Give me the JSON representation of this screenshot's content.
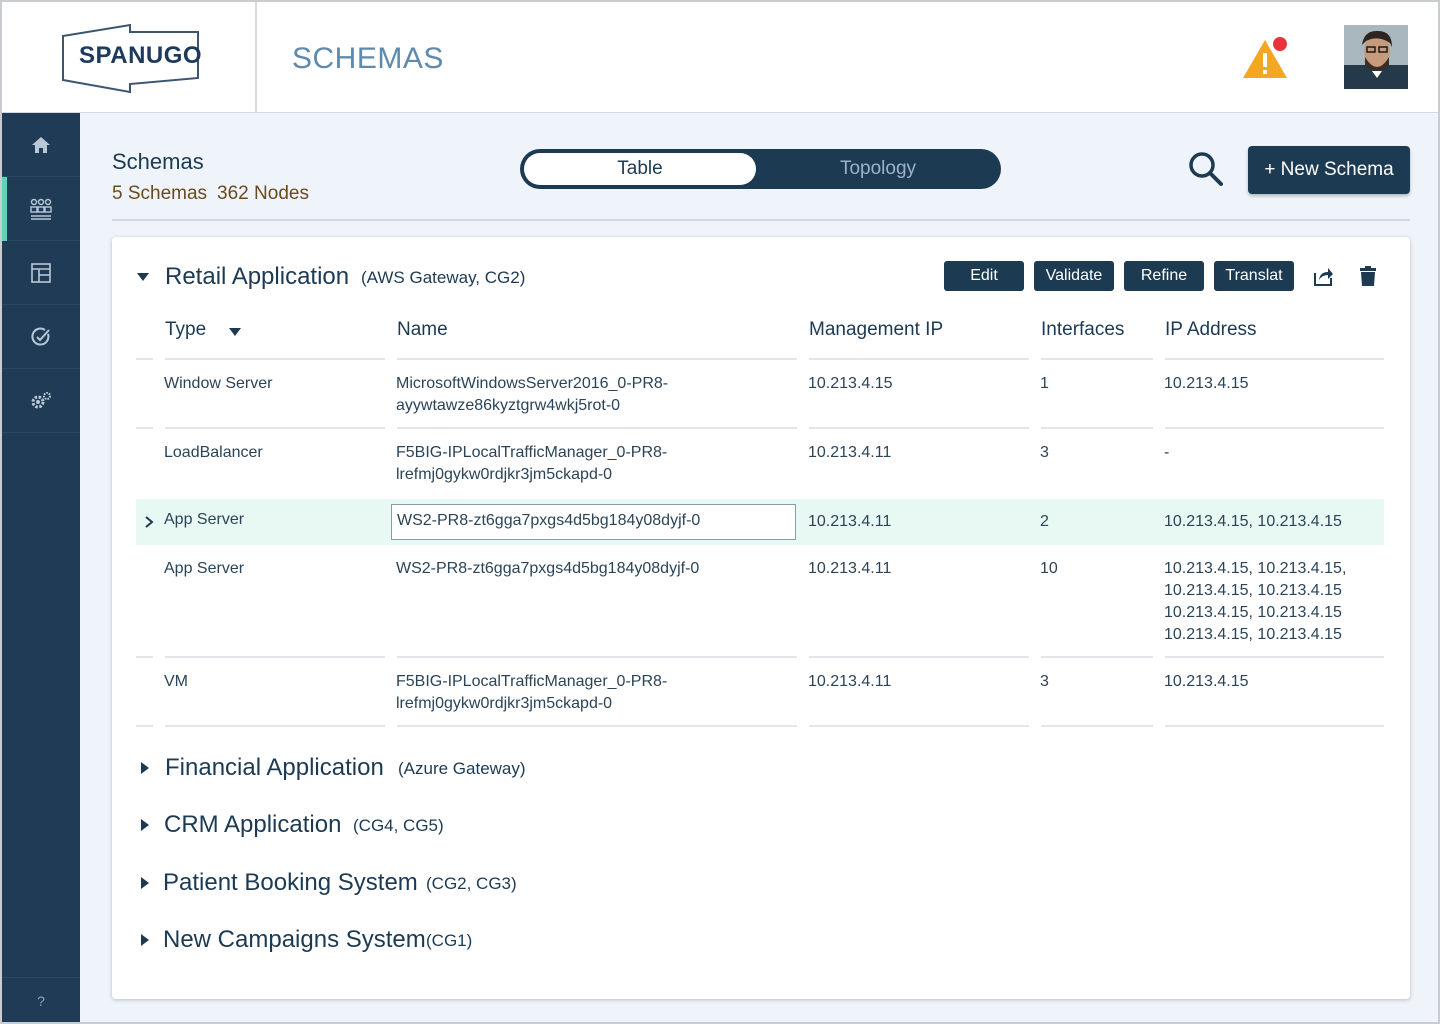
{
  "app": {
    "logo_text": "SPANUGO",
    "page_title": "SCHEMAS"
  },
  "header": {
    "alert_icon": "warning-icon",
    "avatar_icon": "user-avatar"
  },
  "sidebar": {
    "items": [
      {
        "icon": "home-icon"
      },
      {
        "icon": "schemas-icon",
        "active": true
      },
      {
        "icon": "layout-icon"
      },
      {
        "icon": "check-icon"
      },
      {
        "icon": "settings-icon"
      }
    ],
    "help_label": "?"
  },
  "toolbar": {
    "title": "Schemas",
    "schema_count": "5 Schemas",
    "node_count": "362 Nodes",
    "view_tabs": [
      "Table",
      "Topology"
    ],
    "active_tab": "Table",
    "new_button_label": "+ New Schema"
  },
  "schema_groups": [
    {
      "name": "Retail Application",
      "tags": "(AWS Gateway, CG2)",
      "expanded": true,
      "actions": [
        "Edit",
        "Validate",
        "Refine",
        "Translat"
      ],
      "columns": [
        "Type",
        "Name",
        "Management IP",
        "Interfaces",
        "IP Address"
      ],
      "rows": [
        {
          "type": "Window Server",
          "name_line1": "MicrosoftWindowsServer2016_0-PR8-",
          "name_line2": "ayywtawze86kyztgrw4wkj5rot-0",
          "mgmt_ip": "10.213.4.15",
          "interfaces": "1",
          "ip_lines": [
            "10.213.4.15"
          ]
        },
        {
          "type": "LoadBalancer",
          "name_line1": "F5BIG-IPLocalTrafficManager_0-PR8-",
          "name_line2": "lrefmj0gykw0rdjkr3jm5ckapd-0",
          "mgmt_ip": "10.213.4.11",
          "interfaces": "3",
          "ip_lines": [
            "-"
          ]
        },
        {
          "type": "App Server",
          "name_line1": "WS2-PR8-zt6gga7pxgs4d5bg184y08dyjf-0",
          "name_line2": "",
          "mgmt_ip": "10.213.4.11",
          "interfaces": "2",
          "ip_lines": [
            "10.213.4.15, 10.213.4.15"
          ],
          "selected": true
        },
        {
          "type": "App Server",
          "name_line1": "WS2-PR8-zt6gga7pxgs4d5bg184y08dyjf-0",
          "name_line2": "",
          "mgmt_ip": "10.213.4.11",
          "interfaces": "10",
          "ip_lines": [
            "10.213.4.15, 10.213.4.15,",
            "10.213.4.15, 10.213.4.15",
            "10.213.4.15, 10.213.4.15",
            "10.213.4.15, 10.213.4.15"
          ]
        },
        {
          "type": "VM",
          "name_line1": "F5BIG-IPLocalTrafficManager_0-PR8-",
          "name_line2": "lrefmj0gykw0rdjkr3jm5ckapd-0",
          "mgmt_ip": "10.213.4.11",
          "interfaces": "3",
          "ip_lines": [
            "10.213.4.15"
          ]
        }
      ]
    },
    {
      "name": "Financial Application",
      "tags": "(Azure Gateway)",
      "expanded": false
    },
    {
      "name": "CRM Application",
      "tags": "(CG4, CG5)",
      "expanded": false
    },
    {
      "name": "Patient Booking System",
      "tags": "(CG2, CG3)",
      "expanded": false
    },
    {
      "name": "New Campaigns System",
      "tags": "(CG1)",
      "expanded": false
    }
  ],
  "colors": {
    "navy": "#1d3a53",
    "accent": "#5fd3b4",
    "alert": "#f5a623",
    "alert_dot": "#e8333a",
    "row_highlight": "#e8f8f2"
  }
}
